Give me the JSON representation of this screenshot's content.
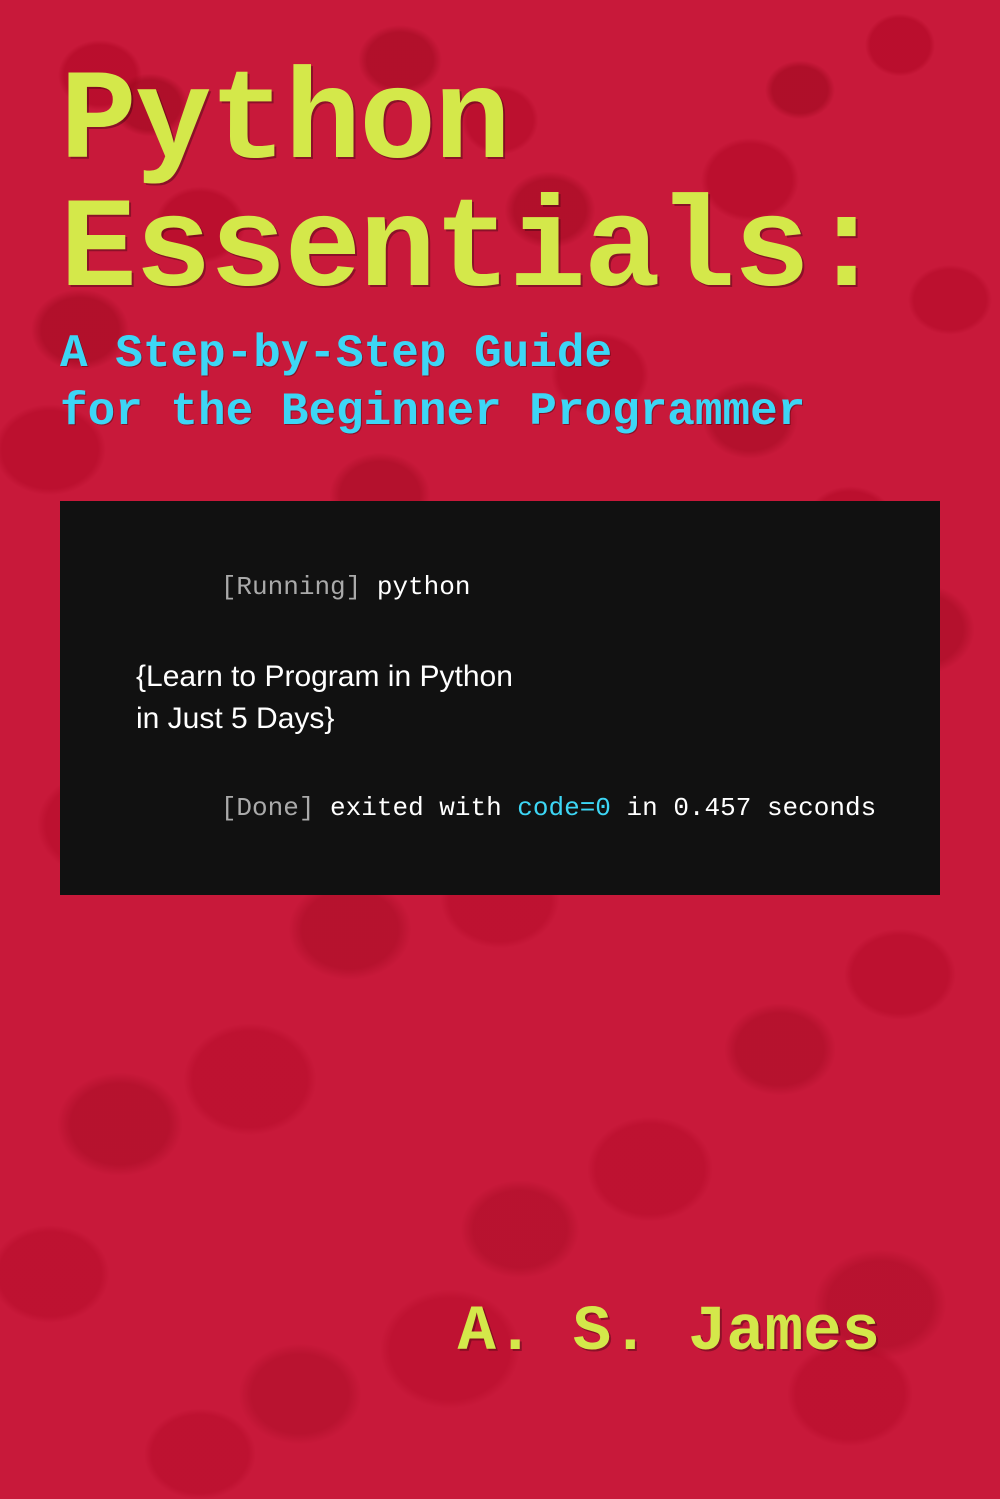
{
  "cover": {
    "background_color": "#c8193a",
    "title_line1": "Python",
    "title_line2": "Essentials:",
    "subtitle_line1": "A Step-by-Step Guide",
    "subtitle_line2": "for the Beginner Programmer",
    "terminal": {
      "running_label": "[Running]",
      "running_command": " python",
      "output_line1": "{Learn to Program in Python",
      "output_line2": "in Just 5 Days}",
      "done_label": "[Done]",
      "done_text": " exited with ",
      "done_code": "code=0",
      "done_suffix": " in 0.457 seconds"
    },
    "author": "A. S. James"
  }
}
